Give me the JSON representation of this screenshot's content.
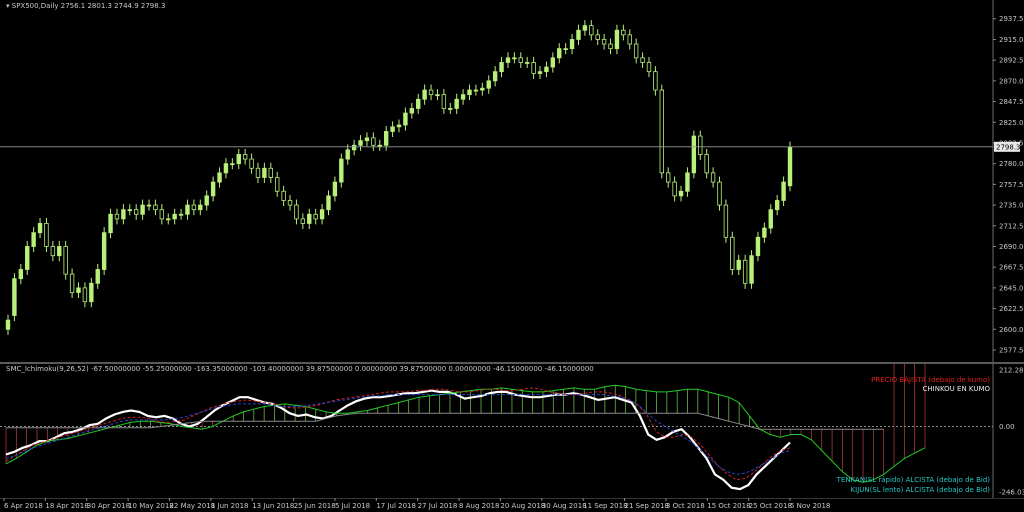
{
  "main_header": {
    "symbol_label": "SPX500,Daily",
    "ohlc": "2756.1 2801.3 2744.9 2798.3"
  },
  "indicator_header": "SMC_Ichimoku(9,26,52) -67.50000000 -55.25000000 -163.35000000 -103.40000000 39.87500000 0.00000000 39.87500000 0.00000000 -46.15000000 -46.15000000",
  "notes": {
    "precio": "PRECIO BAJISTA (debajo de kumo)",
    "chinkou": "CHINKOU EN KUMO",
    "tenkan": "TENKAN(SL rápido) ALCISTA (debajo de Bid)",
    "kijun": "KIJUN(SL lento) ALCISTA (debajo de Bid)"
  },
  "colors": {
    "candle": "#b8f07a",
    "bid_line": "#9a9a9a",
    "precio": "#e02020",
    "chinkou": "#e8e8e8",
    "tenkan_note": "#26c6c6",
    "kijun_note": "#26c6c6",
    "chikou_line": "#ffffff",
    "senkou_a": "#22cc22",
    "senkou_b": "#8a8a8a",
    "tenkan_line": "#cc2222",
    "kijun_line": "#2244cc"
  },
  "chart_data": [
    {
      "type": "candlestick",
      "title": "SPX500,Daily",
      "ylim": [
        2577.5,
        2947
      ],
      "y_ticks": [
        "2937.5",
        "2915.0",
        "2892.5",
        "2870.0",
        "2847.5",
        "2825.0",
        "2802.5",
        "2780.0",
        "2757.5",
        "2735.0",
        "2712.5",
        "2690.0",
        "2667.5",
        "2645.0",
        "2622.5",
        "2600.0",
        "2577.5"
      ],
      "current_price_label": "2798.3",
      "x_ticks": [
        "6 Apr 2018",
        "18 Apr 2018",
        "30 Apr 2018",
        "10 May 2018",
        "22 May 2018",
        "1 Jun 2018",
        "13 Jun 2018",
        "25 Jun 2018",
        "5 Jul 2018",
        "17 Jul 2018",
        "27 Jul 2018",
        "8 Aug 2018",
        "20 Aug 2018",
        "30 Aug 2018",
        "11 Sep 2018",
        "21 Sep 2018",
        "3 Oct 2018",
        "15 Oct 2018",
        "25 Oct 2018",
        "5 Nov 2018"
      ],
      "closes": [
        2610,
        2655,
        2665,
        2690,
        2705,
        2715,
        2690,
        2680,
        2690,
        2660,
        2640,
        2645,
        2630,
        2650,
        2665,
        2705,
        2725,
        2720,
        2730,
        2730,
        2725,
        2735,
        2735,
        2730,
        2720,
        2720,
        2725,
        2725,
        2735,
        2730,
        2735,
        2745,
        2760,
        2770,
        2780,
        2780,
        2790,
        2785,
        2775,
        2765,
        2775,
        2765,
        2750,
        2740,
        2735,
        2720,
        2715,
        2725,
        2720,
        2730,
        2745,
        2760,
        2785,
        2795,
        2800,
        2805,
        2808,
        2800,
        2800,
        2815,
        2820,
        2822,
        2835,
        2840,
        2850,
        2860,
        2855,
        2855,
        2840,
        2840,
        2850,
        2855,
        2860,
        2860,
        2862,
        2870,
        2880,
        2890,
        2895,
        2895,
        2890,
        2890,
        2878,
        2880,
        2885,
        2895,
        2905,
        2905,
        2915,
        2925,
        2930,
        2920,
        2915,
        2910,
        2905,
        2925,
        2920,
        2910,
        2895,
        2890,
        2880,
        2860,
        2770,
        2760,
        2745,
        2750,
        2770,
        2810,
        2790,
        2770,
        2760,
        2735,
        2700,
        2665,
        2675,
        2650,
        2680,
        2700,
        2710,
        2730,
        2740,
        2760,
        2798
      ],
      "opens": [
        2600,
        2615,
        2655,
        2665,
        2690,
        2705,
        2715,
        2690,
        2680,
        2690,
        2660,
        2640,
        2645,
        2630,
        2650,
        2665,
        2705,
        2725,
        2720,
        2730,
        2730,
        2725,
        2735,
        2735,
        2730,
        2720,
        2720,
        2725,
        2725,
        2735,
        2730,
        2735,
        2745,
        2760,
        2770,
        2780,
        2780,
        2790,
        2785,
        2775,
        2765,
        2775,
        2765,
        2750,
        2740,
        2735,
        2720,
        2715,
        2725,
        2720,
        2730,
        2745,
        2760,
        2785,
        2795,
        2800,
        2805,
        2808,
        2800,
        2800,
        2815,
        2820,
        2822,
        2835,
        2840,
        2850,
        2860,
        2855,
        2855,
        2840,
        2840,
        2850,
        2855,
        2860,
        2860,
        2862,
        2870,
        2880,
        2890,
        2895,
        2895,
        2890,
        2890,
        2878,
        2880,
        2885,
        2895,
        2905,
        2905,
        2915,
        2925,
        2930,
        2920,
        2915,
        2910,
        2905,
        2925,
        2920,
        2910,
        2895,
        2890,
        2880,
        2860,
        2770,
        2760,
        2745,
        2750,
        2770,
        2810,
        2790,
        2770,
        2760,
        2735,
        2700,
        2665,
        2675,
        2650,
        2680,
        2700,
        2710,
        2730,
        2740,
        2756
      ]
    },
    {
      "type": "line",
      "title": "SMC_Ichimoku(9,26,52)",
      "ylim": [
        -246.032,
        212.2825
      ],
      "y_ticks": [
        "212.2825",
        "0.00",
        "-246.032"
      ],
      "series": [
        {
          "name": "chikou",
          "color": "#ffffff",
          "values": [
            -105,
            -95,
            -80,
            -70,
            -55,
            -55,
            -40,
            -25,
            -20,
            -10,
            5,
            10,
            30,
            45,
            55,
            60,
            55,
            40,
            35,
            40,
            30,
            10,
            0,
            10,
            35,
            60,
            80,
            95,
            110,
            110,
            100,
            90,
            85,
            70,
            50,
            40,
            45,
            35,
            30,
            40,
            60,
            80,
            95,
            105,
            110,
            110,
            115,
            120,
            125,
            125,
            130,
            135,
            130,
            130,
            120,
            105,
            110,
            115,
            125,
            130,
            130,
            120,
            115,
            110,
            110,
            115,
            120,
            120,
            125,
            120,
            110,
            100,
            105,
            110,
            100,
            90,
            40,
            -30,
            -50,
            -40,
            -20,
            -10,
            -40,
            -80,
            -120,
            -180,
            -200,
            -230,
            -235,
            -220,
            -180,
            -150,
            -120,
            -90,
            -60
          ]
        },
        {
          "name": "senkou_a",
          "color": "#22cc22",
          "values": [
            -140,
            -120,
            -95,
            -70,
            -55,
            -50,
            -45,
            -35,
            -25,
            -15,
            -5,
            5,
            15,
            20,
            20,
            15,
            10,
            0,
            -5,
            -10,
            0,
            20,
            40,
            55,
            65,
            75,
            80,
            85,
            80,
            75,
            65,
            55,
            50,
            50,
            55,
            60,
            70,
            80,
            90,
            100,
            110,
            115,
            120,
            125,
            130,
            135,
            140,
            140,
            145,
            140,
            135,
            130,
            130,
            135,
            140,
            145,
            140,
            140,
            150,
            155,
            150,
            140,
            135,
            130,
            130,
            135,
            140,
            140,
            130,
            120,
            110,
            90,
            40,
            -10,
            -30,
            -40,
            -30,
            -30,
            -50,
            -90,
            -130,
            -170,
            -200,
            -210,
            -200,
            -180,
            -150,
            -120,
            -100,
            -80
          ]
        },
        {
          "name": "senkou_b",
          "color": "#8a8a8a",
          "values": [
            -5,
            -5,
            -5,
            -5,
            -5,
            -5,
            -5,
            -5,
            -5,
            -5,
            -5,
            -5,
            -5,
            -5,
            -5,
            0,
            5,
            10,
            15,
            20,
            20,
            20,
            20,
            20,
            20,
            20,
            20,
            20,
            20,
            20,
            20,
            30,
            40,
            45,
            50,
            50,
            50,
            50,
            50,
            50,
            50,
            50,
            50,
            50,
            50,
            50,
            50,
            50,
            50,
            50,
            50,
            50,
            50,
            50,
            50,
            50,
            50,
            50,
            50,
            50,
            50,
            50,
            50,
            50,
            50,
            50,
            50,
            50,
            40,
            30,
            20,
            10,
            0,
            -10,
            -10,
            -10,
            -10,
            -10,
            -10,
            -10,
            -10,
            -10,
            -10,
            -10,
            -10,
            -10
          ]
        },
        {
          "name": "tenkan",
          "color": "#cc2222",
          "values": [
            -130,
            -110,
            -90,
            -70,
            -60,
            -50,
            -40,
            -30,
            -20,
            -10,
            0,
            10,
            20,
            30,
            35,
            35,
            30,
            20,
            15,
            20,
            25,
            40,
            55,
            70,
            80,
            90,
            95,
            100,
            95,
            90,
            85,
            75,
            70,
            70,
            75,
            80,
            90,
            100,
            105,
            110,
            115,
            120,
            125,
            130,
            130,
            130,
            135,
            135,
            140,
            140,
            135,
            130,
            130,
            135,
            140,
            140,
            135,
            135,
            140,
            145,
            140,
            130,
            125,
            120,
            120,
            125,
            130,
            130,
            125,
            115,
            100,
            80,
            40,
            -20,
            -40,
            -40,
            -30,
            -40,
            -70,
            -110,
            -150,
            -180,
            -200,
            -195,
            -170,
            -140,
            -110,
            -90,
            -80
          ]
        },
        {
          "name": "kijun",
          "color": "#2244cc",
          "values": [
            -120,
            -110,
            -95,
            -80,
            -70,
            -60,
            -50,
            -40,
            -30,
            -20,
            -10,
            0,
            10,
            20,
            25,
            25,
            25,
            25,
            25,
            30,
            35,
            45,
            55,
            65,
            75,
            80,
            85,
            85,
            85,
            85,
            80,
            75,
            75,
            75,
            80,
            85,
            90,
            95,
            100,
            105,
            110,
            115,
            115,
            120,
            120,
            120,
            120,
            120,
            120,
            120,
            120,
            120,
            120,
            120,
            120,
            120,
            120,
            120,
            120,
            120,
            120,
            120,
            120,
            120,
            120,
            120,
            120,
            120,
            115,
            110,
            100,
            80,
            50,
            20,
            0,
            -20,
            -40,
            -60,
            -90,
            -120,
            -150,
            -170,
            -180,
            -175,
            -160,
            -140,
            -120,
            -100,
            -90
          ]
        }
      ]
    }
  ]
}
